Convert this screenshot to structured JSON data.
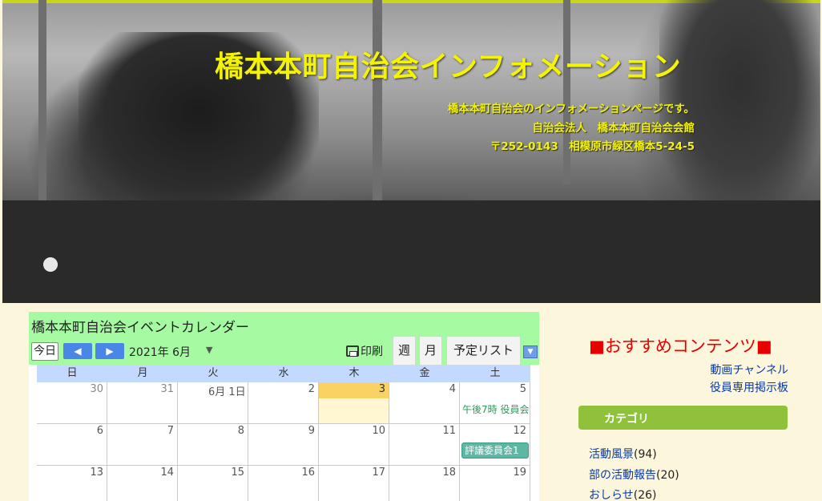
{
  "banner": {
    "title": "橋本本町自治会インフォメーション",
    "line1": "橋本本町自治会のインフォメーションページです。",
    "line2": "自治会法人　橋本本町自治会会館",
    "line3": "〒252-0143　相模原市緑区橋本5-24-5"
  },
  "calendar": {
    "title": "橋本本町自治会イベントカレンダー",
    "today_label": "今日",
    "prev_icon": "◀",
    "next_icon": "▶",
    "month_label": "2021年 6月",
    "print_label": "印刷",
    "tabs": {
      "week": "週",
      "month": "月",
      "list": "予定リスト"
    },
    "weekdays": [
      "日",
      "月",
      "火",
      "水",
      "木",
      "金",
      "土"
    ],
    "weeks": [
      [
        "30",
        "31",
        "6月 1日",
        "2",
        "3",
        "4",
        "5"
      ],
      [
        "6",
        "7",
        "8",
        "9",
        "10",
        "11",
        "12"
      ],
      [
        "13",
        "14",
        "15",
        "16",
        "17",
        "18",
        "19"
      ]
    ],
    "events": {
      "sat_week1": "午後7時 役員会",
      "sat_week2": "評議委員会1"
    }
  },
  "sidebar": {
    "recommend_title": "■おすすめコンテンツ■",
    "links": [
      "動画チャンネル",
      "役員専用掲示板"
    ],
    "category_header": "カテゴリ",
    "categories": [
      {
        "label": "活動風景",
        "count": "(94)"
      },
      {
        "label": "部の活動報告",
        "count": "(20)"
      },
      {
        "label": "おしらせ",
        "count": "(26)"
      }
    ]
  },
  "colors": {
    "banner_text": "#f4f400",
    "calendar_header": "#a6fba2",
    "today_cell": "#fad163",
    "category_bar": "#8fc23a",
    "recommend_text": "#e60000"
  }
}
